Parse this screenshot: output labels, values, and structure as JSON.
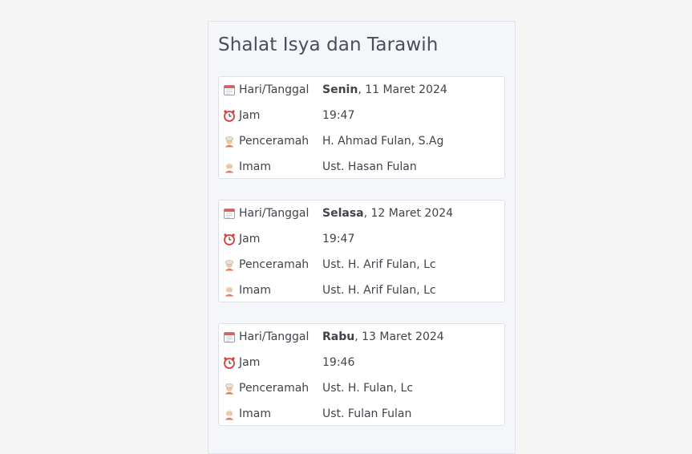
{
  "title": "Shalat Isya dan Tarawih",
  "labels": {
    "date": "Hari/Tanggal",
    "time": "Jam",
    "speaker": "Penceramah",
    "imam": "Imam"
  },
  "icons": {
    "date": "calendar-icon",
    "time": "alarm-clock-icon",
    "speaker": "man-with-turban-icon",
    "imam": "old-man-icon"
  },
  "schedule": [
    {
      "day": "Senin",
      "date": ", 11 Maret 2024",
      "time": "19:47",
      "speaker": "H. Ahmad Fulan, S.Ag",
      "imam": "Ust. Hasan Fulan"
    },
    {
      "day": "Selasa",
      "date": ", 12 Maret 2024",
      "time": "19:47",
      "speaker": "Ust. H. Arif Fulan, Lc",
      "imam": "Ust. H. Arif Fulan, Lc"
    },
    {
      "day": "Rabu",
      "date": ", 13 Maret 2024",
      "time": "19:46",
      "speaker": "Ust. H. Fulan, Lc",
      "imam": "Ust. Fulan Fulan"
    }
  ]
}
